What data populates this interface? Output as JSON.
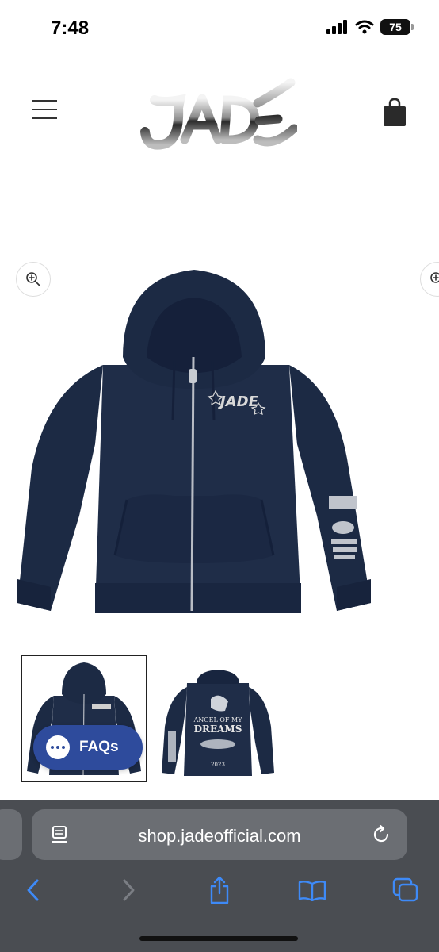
{
  "status_bar": {
    "time": "7:48",
    "battery": "75"
  },
  "header": {
    "brand": "JADE"
  },
  "product": {
    "chest_print": "JADE",
    "back_print_lines": [
      "ANGEL OF MY",
      "DREAMS"
    ],
    "back_year": "2023"
  },
  "chat_widget": {
    "label": "FAQs"
  },
  "browser": {
    "url": "shop.jadeofficial.com"
  },
  "colors": {
    "accent": "#2e4b9c",
    "hoodie": "#1c2a44",
    "chrome": "#4a4d52",
    "ios_blue": "#3e8af7"
  }
}
